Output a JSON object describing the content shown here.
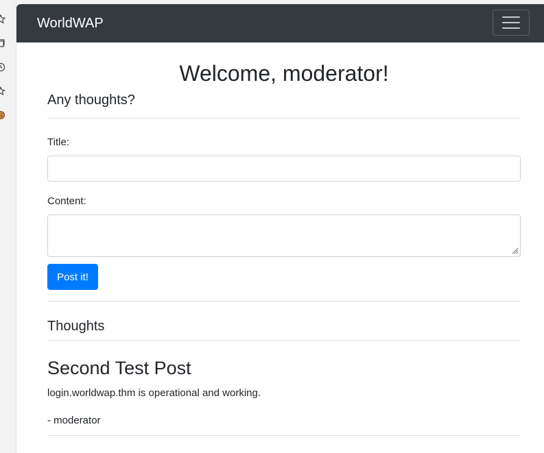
{
  "navbar": {
    "brand": "WorldWAP"
  },
  "main": {
    "welcome": "Welcome, moderator!",
    "compose_heading": "Any thoughts?",
    "title_label": "Title:",
    "title_value": "",
    "content_label": "Content:",
    "content_value": "",
    "submit_label": "Post it!",
    "thoughts_heading": "Thoughts"
  },
  "posts": [
    {
      "title": "Second Test Post",
      "content": "login.worldwap.thm is operational and working.",
      "author": "- moderator"
    }
  ],
  "colors": {
    "navbar_bg": "#343a40",
    "primary": "#007bff",
    "border": "#dee2e6"
  },
  "icons": {
    "sidebar": [
      "star-icon",
      "collections-icon",
      "history-icon",
      "favorites-icon",
      "cookie-icon"
    ],
    "menu": "hamburger-icon"
  }
}
